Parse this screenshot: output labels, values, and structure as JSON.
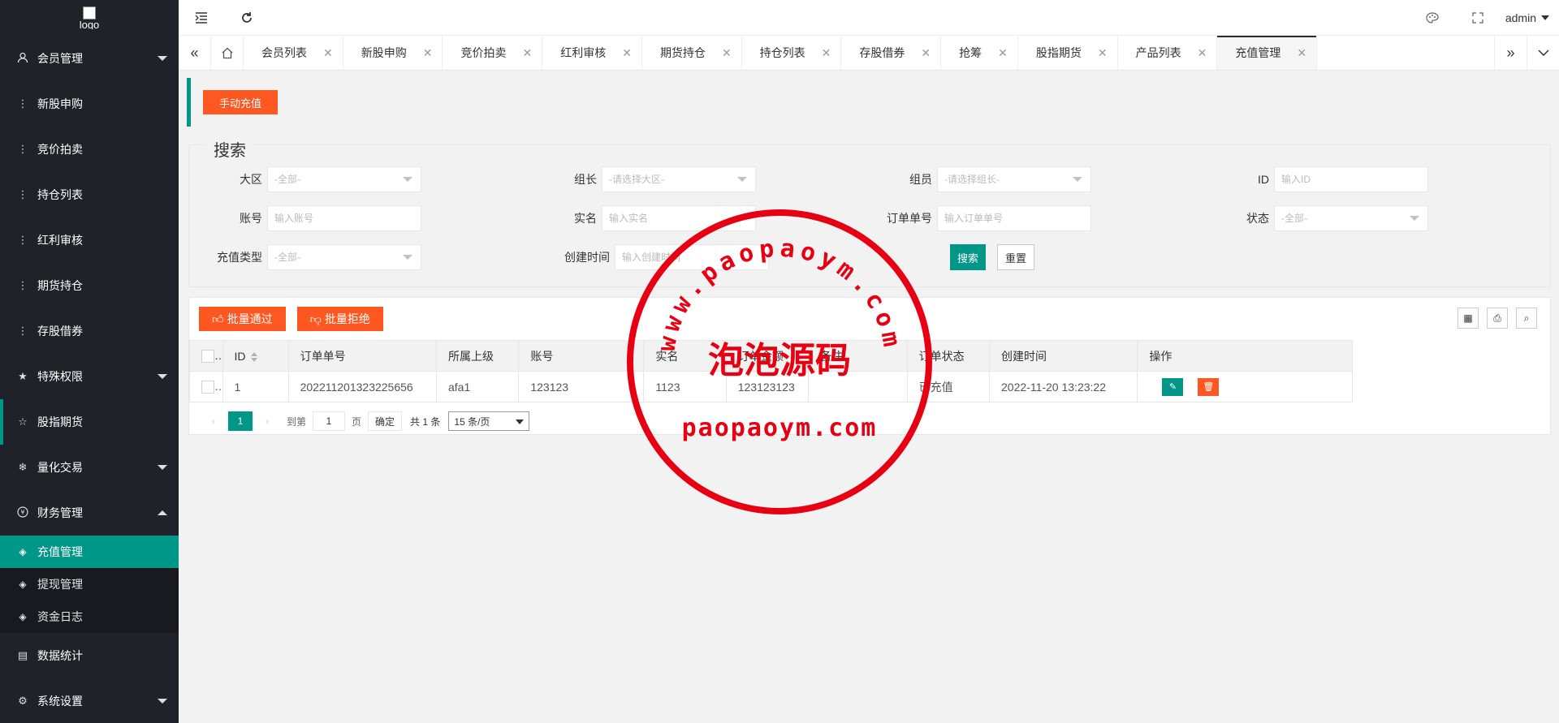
{
  "logo_alt": "logo",
  "sidebar": {
    "items": [
      {
        "label": "会员管理",
        "icon": "user-icon",
        "caret": "down"
      },
      {
        "label": "新股申购",
        "icon": "dots-icon"
      },
      {
        "label": "竞价拍卖",
        "icon": "dots-icon"
      },
      {
        "label": "持仓列表",
        "icon": "dots-icon"
      },
      {
        "label": "红利审核",
        "icon": "dots-icon"
      },
      {
        "label": "期货持仓",
        "icon": "dots-icon"
      },
      {
        "label": "存股借券",
        "icon": "dots-icon"
      },
      {
        "label": "特殊权限",
        "icon": "star-icon",
        "caret": "down"
      },
      {
        "label": "股指期货",
        "icon": "star-outline-icon"
      },
      {
        "label": "量化交易",
        "icon": "snowflake-icon",
        "caret": "down"
      },
      {
        "label": "财务管理",
        "icon": "yen-icon",
        "caret": "up"
      }
    ],
    "finance_sub": [
      {
        "label": "充值管理",
        "icon": "diamond-icon",
        "active": true
      },
      {
        "label": "提现管理",
        "icon": "diamond-icon"
      },
      {
        "label": "资金日志",
        "icon": "diamond-icon"
      }
    ],
    "bottom": [
      {
        "label": "数据统计",
        "icon": "calendar-icon"
      },
      {
        "label": "系统设置",
        "icon": "gear-icon",
        "caret": "down"
      }
    ]
  },
  "header": {
    "user": "admin"
  },
  "tabs": [
    "会员列表",
    "新股申购",
    "竞价拍卖",
    "红利审核",
    "期货持仓",
    "持仓列表",
    "存股借券",
    "抢筹",
    "股指期货",
    "产品列表",
    "充值管理"
  ],
  "active_tab": "充值管理",
  "toolbar": {
    "manual_recharge": "手动充值"
  },
  "search": {
    "legend": "搜索",
    "fields": {
      "region_label": "大区",
      "region_value": "-全部-",
      "leader_label": "组长",
      "leader_placeholder": "-请选择大区-",
      "member_label": "组员",
      "member_placeholder": "-请选择组长-",
      "id_label": "ID",
      "id_placeholder": "输入ID",
      "account_label": "账号",
      "account_placeholder": "输入账号",
      "realname_label": "实名",
      "realname_placeholder": "输入实名",
      "order_label": "订单单号",
      "order_placeholder": "输入订单单号",
      "status_label": "状态",
      "status_value": "-全部-",
      "type_label": "充值类型",
      "type_value": "-全部-",
      "created_label": "创建时间",
      "created_placeholder": "输入创建时间"
    },
    "search_btn": "搜索",
    "reset_btn": "重置"
  },
  "table": {
    "batch_pass": "批量通过",
    "batch_reject": "批量拒绝",
    "columns": [
      "ID",
      "订单单号",
      "所属上级",
      "账号",
      "实名",
      "订单金额",
      "备注",
      "订单状态",
      "创建时间",
      "操作"
    ],
    "rows": [
      {
        "id": "1",
        "order": "202211201323225656",
        "parent": "afa1",
        "account": "123123",
        "realname": "1123",
        "amount": "123123123",
        "remark": "",
        "status": "已充值",
        "created": "2022-11-20 13:23:22"
      }
    ]
  },
  "pager": {
    "current": "1",
    "goto": "到第",
    "page_value": "1",
    "page_unit": "页",
    "ok": "确定",
    "total": "共 1 条",
    "page_size": "15 条/页"
  },
  "watermark": {
    "url_top": "www.paopaoym.com",
    "cn": "泡泡源码",
    "url_bottom": "paopaoym.com"
  },
  "colors": {
    "accent": "#009688",
    "orange": "#ff5722",
    "sidebar": "#20222a",
    "stamp": "#e60012"
  }
}
